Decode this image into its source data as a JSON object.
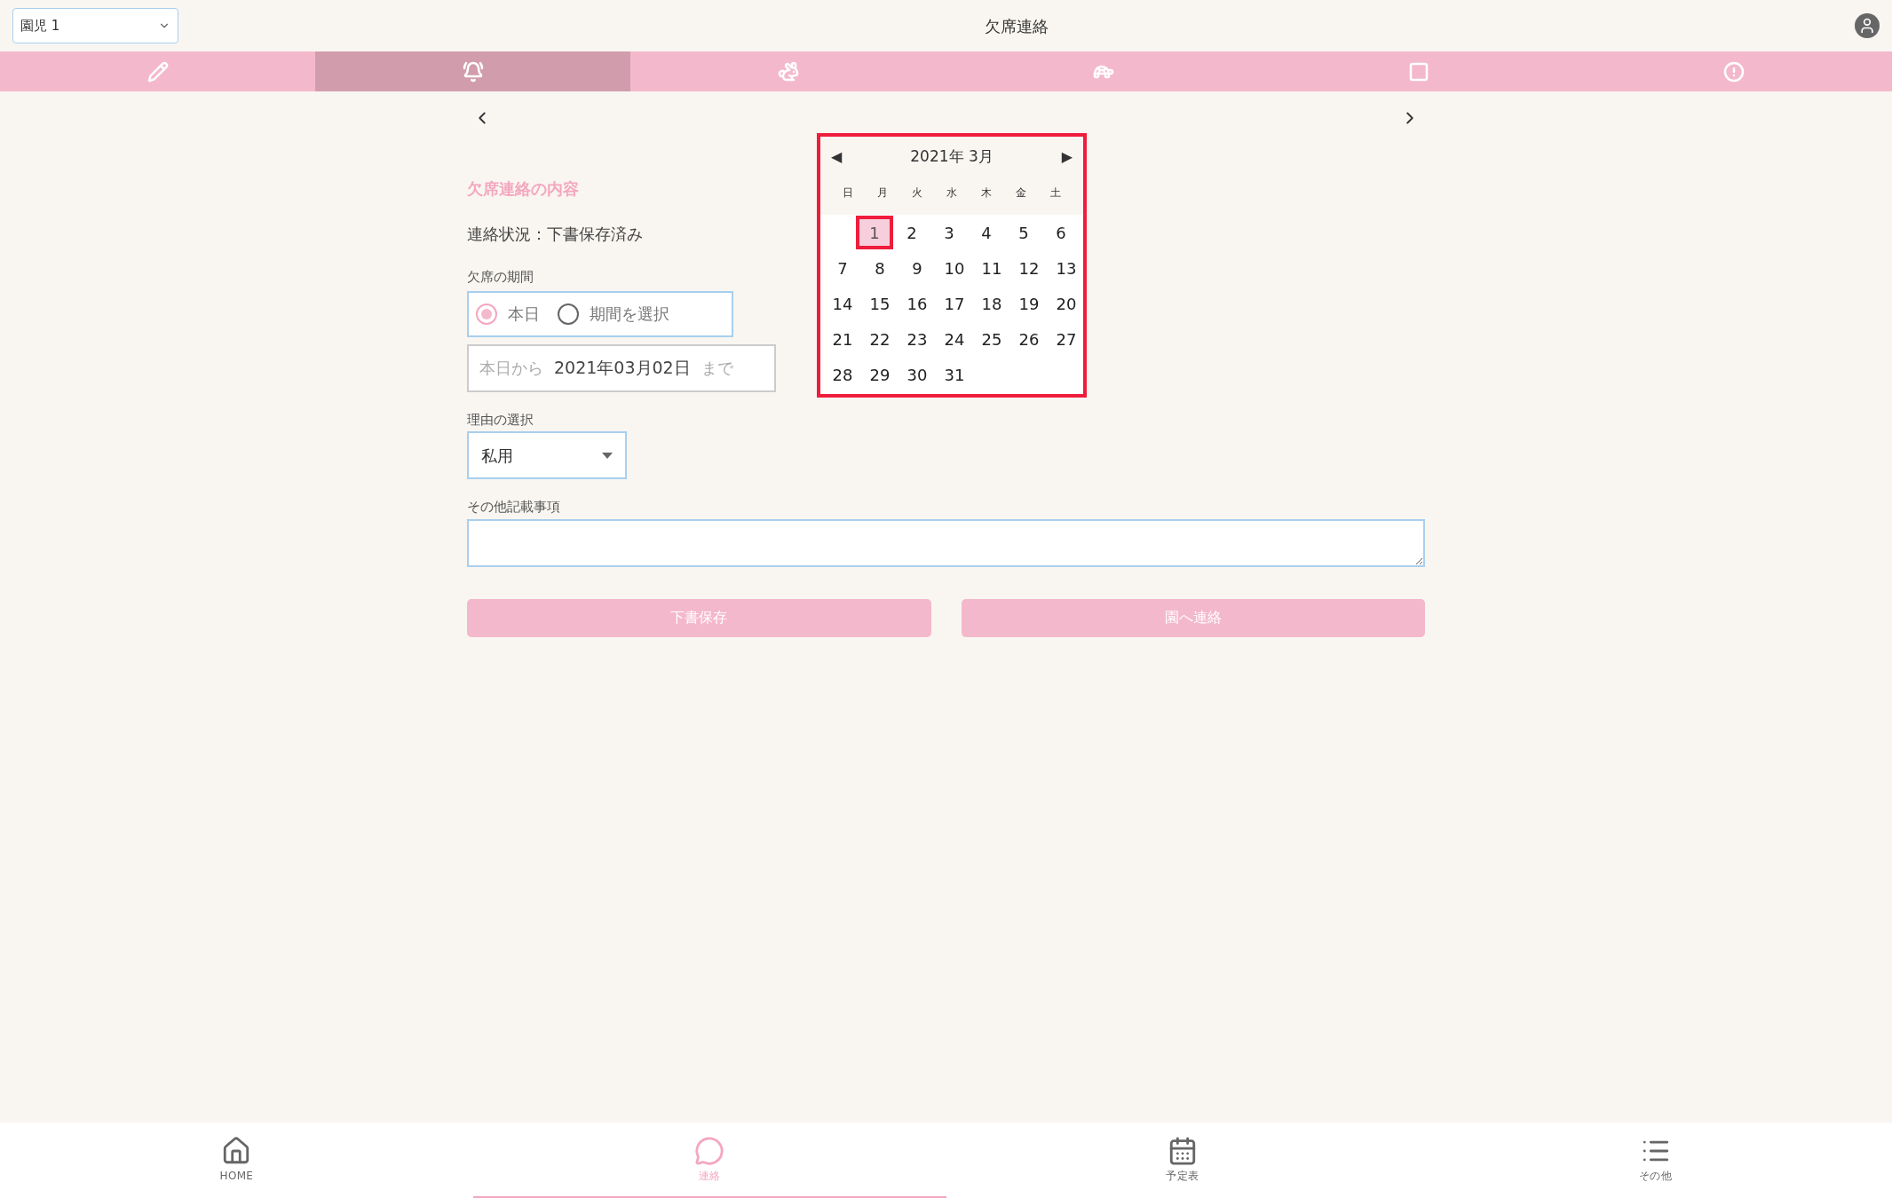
{
  "header": {
    "child_select": "園児 1",
    "title": "欠席連絡"
  },
  "tabs": [
    {
      "selected": false
    },
    {
      "selected": true
    },
    {
      "selected": false
    },
    {
      "selected": false
    },
    {
      "selected": false
    },
    {
      "selected": false
    }
  ],
  "form": {
    "section_title": "欠席連絡の内容",
    "status": "連絡状況：下書保存済み",
    "period_label": "欠席の期間",
    "period_options": [
      {
        "label": "本日",
        "selected": true
      },
      {
        "label": "期間を選択",
        "selected": false
      }
    ],
    "range": {
      "prefix": "本日から",
      "value": "2021年03月02日",
      "suffix": "まで"
    },
    "reason_label": "理由の選択",
    "reason_value": "私用",
    "notes_label": "その他記載事項",
    "buttons": [
      "下書保存",
      "園へ連絡"
    ]
  },
  "calendar": {
    "prev": "◀",
    "next": "▶",
    "title": "2021年 3月",
    "weekdays": [
      "日",
      "月",
      "火",
      "水",
      "木",
      "金",
      "土"
    ],
    "weeks": [
      [
        {
          "label": "1",
          "selected": true
        },
        {
          "label": "2",
          "selected": false
        },
        {
          "label": "3",
          "selected": false
        },
        {
          "label": "4",
          "selected": false
        },
        {
          "label": "5",
          "selected": false
        },
        {
          "label": "6",
          "selected": false
        }
      ],
      [
        {
          "label": "7",
          "selected": false
        },
        {
          "label": "8",
          "selected": false
        },
        {
          "label": "9",
          "selected": false
        },
        {
          "label": "10",
          "selected": false
        },
        {
          "label": "11",
          "selected": false
        },
        {
          "label": "12",
          "selected": false
        },
        {
          "label": "13",
          "selected": false
        }
      ],
      [
        {
          "label": "14",
          "selected": false
        },
        {
          "label": "15",
          "selected": false
        },
        {
          "label": "16",
          "selected": false
        },
        {
          "label": "17",
          "selected": false
        },
        {
          "label": "18",
          "selected": false
        },
        {
          "label": "19",
          "selected": false
        },
        {
          "label": "20",
          "selected": false
        }
      ],
      [
        {
          "label": "21",
          "selected": false
        },
        {
          "label": "22",
          "selected": false
        },
        {
          "label": "23",
          "selected": false
        },
        {
          "label": "24",
          "selected": false
        },
        {
          "label": "25",
          "selected": false
        },
        {
          "label": "26",
          "selected": false
        },
        {
          "label": "27",
          "selected": false
        }
      ],
      [
        {
          "label": "28",
          "selected": false
        },
        {
          "label": "29",
          "selected": false
        },
        {
          "label": "30",
          "selected": false
        },
        {
          "label": "31",
          "selected": false
        }
      ]
    ]
  },
  "bottom_nav": [
    {
      "label": "HOME",
      "selected": false
    },
    {
      "label": "連絡",
      "selected": true
    },
    {
      "label": "予定表",
      "selected": false
    },
    {
      "label": "その他",
      "selected": false
    }
  ]
}
